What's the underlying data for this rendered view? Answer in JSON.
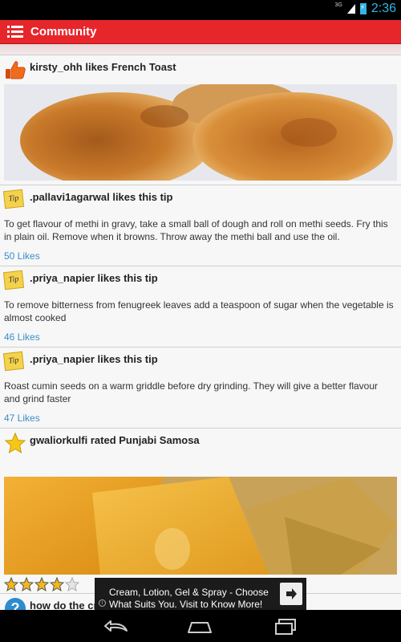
{
  "status_bar": {
    "network": "3G",
    "time": "2:36"
  },
  "action_bar": {
    "title": "Community",
    "menu_icon": "hamburger-menu-icon"
  },
  "colors": {
    "accent": "#e7262b",
    "link": "#3a8ec7",
    "status_blue": "#33b5e5"
  },
  "feed": {
    "items": [
      {
        "type": "like",
        "icon": "thumbs-up-icon",
        "text": "kirsty_ohh likes French Toast"
      },
      {
        "type": "tip",
        "icon": "tip-note-icon",
        "icon_text": "Tip",
        "text": ".pallavi1agarwal likes this tip",
        "body": "To get flavour of methi in gravy, take a small ball of dough and roll on methi seeds. Fry this in plain oil. Remove when it browns. Throw away the methi ball and use the oil.",
        "likes": "50 Likes"
      },
      {
        "type": "tip",
        "icon": "tip-note-icon",
        "icon_text": "Tip",
        "text": ".priya_napier likes this tip",
        "body": "To remove bitterness from fenugreek leaves add a teaspoon of sugar when the vegetable is almost cooked",
        "likes": "46 Likes"
      },
      {
        "type": "tip",
        "icon": "tip-note-icon",
        "icon_text": "Tip",
        "text": ".priya_napier likes this tip",
        "body": "Roast cumin seeds on a warm griddle before dry grinding. They will give a better flavour and grind faster",
        "likes": "47 Likes"
      },
      {
        "type": "rating",
        "icon": "star-icon",
        "text": "gwaliorkulfi rated Punjabi Samosa",
        "rating": 4,
        "rating_max": 5
      },
      {
        "type": "question",
        "icon": "question-icon",
        "text": "how do the cr"
      }
    ]
  },
  "ad": {
    "line1": "Cream, Lotion, Gel & Spray - Choose",
    "line2": "What Suits You. Visit to Know More!",
    "info_icon": "info-icon",
    "arrow_icon": "arrow-right-icon"
  },
  "nav": {
    "back": "back-icon",
    "home": "home-icon",
    "recents": "recent-apps-icon"
  }
}
